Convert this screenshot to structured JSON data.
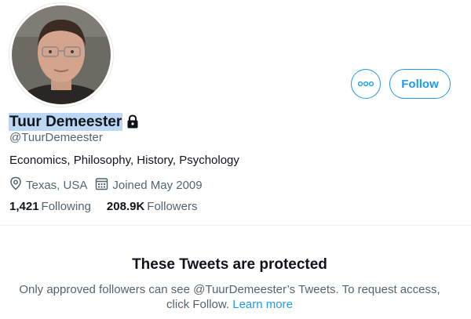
{
  "profile": {
    "display_name": "Tuur Demeester",
    "handle": "@TuurDemeester",
    "bio": "Economics, Philosophy, History, Psychology",
    "location": "Texas, USA",
    "joined": "Joined May 2009",
    "following_count": "1,421",
    "following_label": "Following",
    "followers_count": "208.9K",
    "followers_label": "Followers",
    "protected": true
  },
  "actions": {
    "follow_label": "Follow",
    "more_icon": "more-options-icon"
  },
  "protected_notice": {
    "title": "These Tweets are protected",
    "text_before": "Only approved followers can see @TuurDemeester’s Tweets. To request access, click Follow.",
    "learn_more": "Learn more"
  },
  "colors": {
    "accent": "#1d9bf0",
    "secondary_text": "#536471",
    "name_highlight": "#bcd7f4"
  }
}
